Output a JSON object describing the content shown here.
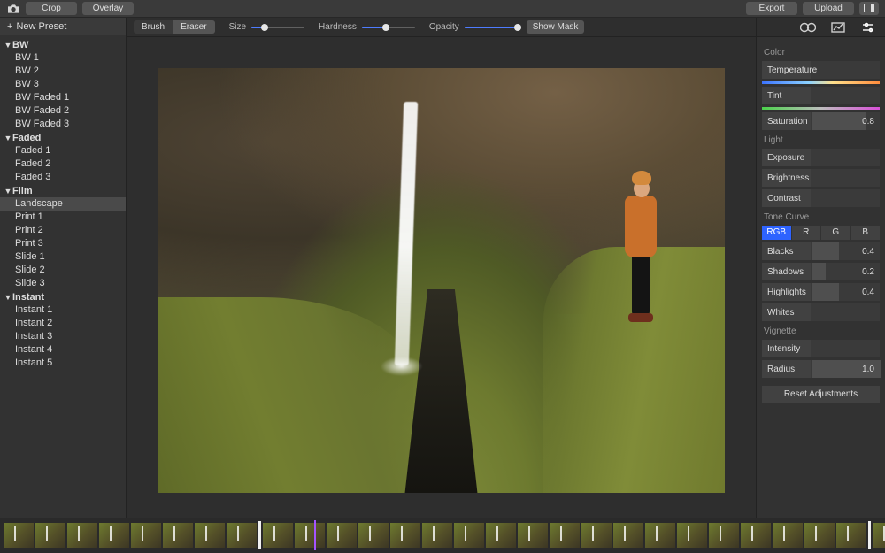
{
  "topbar": {
    "crop": "Crop",
    "overlay": "Overlay",
    "export": "Export",
    "upload": "Upload"
  },
  "new_preset": "New Preset",
  "preset_tree": [
    {
      "group": "BW",
      "items": [
        "BW 1",
        "BW 2",
        "BW 3",
        "BW Faded 1",
        "BW Faded 2",
        "BW Faded 3"
      ]
    },
    {
      "group": "Faded",
      "items": [
        "Faded 1",
        "Faded 2",
        "Faded 3"
      ]
    },
    {
      "group": "Film",
      "items": [
        "Landscape",
        "Print 1",
        "Print 2",
        "Print 3",
        "Slide 1",
        "Slide 2",
        "Slide 3"
      ]
    },
    {
      "group": "Instant",
      "items": [
        "Instant 1",
        "Instant 2",
        "Instant 3",
        "Instant 4",
        "Instant 5"
      ]
    }
  ],
  "selected_preset": "Landscape",
  "brushbar": {
    "brush": "Brush",
    "eraser": "Eraser",
    "size": "Size",
    "hardness": "Hardness",
    "opacity": "Opacity",
    "show_mask": "Show Mask",
    "size_val": 0.25,
    "hardness_val": 0.45,
    "opacity_val": 1.0
  },
  "sections": {
    "color": "Color",
    "light": "Light",
    "tone": "Tone Curve",
    "vignette": "Vignette"
  },
  "color_adj": {
    "temperature": "Temperature",
    "tint": "Tint",
    "saturation": {
      "label": "Saturation",
      "value": "0.8",
      "frac": 0.8
    }
  },
  "light_adj": {
    "exposure": "Exposure",
    "brightness": "Brightness",
    "contrast": "Contrast"
  },
  "tone_channels": {
    "rgb": "RGB",
    "r": "R",
    "g": "G",
    "b": "B"
  },
  "tone_adj": {
    "blacks": {
      "label": "Blacks",
      "value": "0.4",
      "frac": 0.4
    },
    "shadows": {
      "label": "Shadows",
      "value": "0.2",
      "frac": 0.2
    },
    "highlights": {
      "label": "Highlights",
      "value": "0.4",
      "frac": 0.4
    },
    "whites": {
      "label": "Whites"
    }
  },
  "vignette_adj": {
    "intensity": {
      "label": "Intensity"
    },
    "radius": {
      "label": "Radius",
      "value": "1.0",
      "frac": 1.0
    }
  },
  "reset": "Reset Adjustments",
  "filmstrip": {
    "thumbs_before": 8,
    "range_thumbs": 19,
    "thumbs_after": 1
  }
}
